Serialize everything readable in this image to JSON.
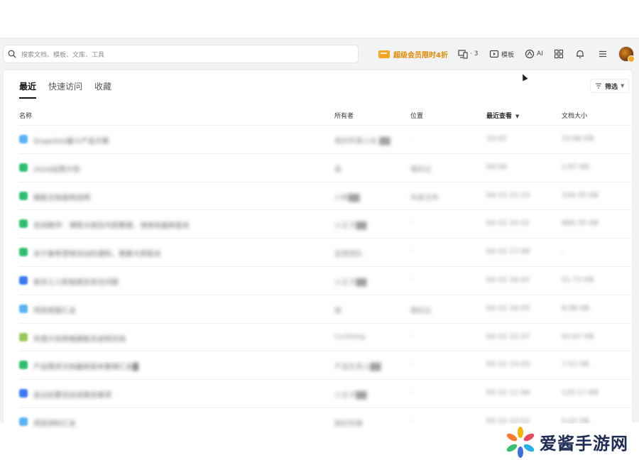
{
  "search": {
    "placeholder": "搜索文档、模板、文库、工具"
  },
  "toolbar": {
    "promo": "超级会员限时4折",
    "devices_count": "· 3",
    "templates": "模板",
    "ai": "AI"
  },
  "tabs": [
    {
      "label": "最近"
    },
    {
      "label": "快速访问"
    },
    {
      "label": "收藏"
    }
  ],
  "filter_label": "筛选",
  "table": {
    "headers": {
      "name": "名称",
      "owner": "所有者",
      "location": "位置",
      "last_viewed": "最近查看",
      "size": "文档大小"
    },
    "rows": [
      {
        "icon_color": "#5ab3f5",
        "name": "Snapshot最小产品方案",
        "owner": "我的同事小名 ▓▓",
        "location": "-",
        "date": "10:42",
        "size": "15.66 KB"
      },
      {
        "icon_color": "#2fbf71",
        "name": "2024运营计划",
        "owner": "我",
        "location": "我的云",
        "date": "09:58",
        "size": "2.87 KB"
      },
      {
        "icon_color": "#2fbf71",
        "name": "模板文档使用说明",
        "owner": "小明▓▓",
        "location": "共享文件",
        "date": "04-15 22:14",
        "size": "109.35 KB"
      },
      {
        "icon_color": "#2fbf71",
        "name": "在线教学：课程大纲及内容整理，请查收最新版本",
        "owner": "小王子▓▓",
        "location": "-",
        "date": "04-15 20:31",
        "size": "689.35 KB"
      },
      {
        "icon_color": "#2fbf71",
        "name": "关于春季营销活动的通知，需要大家配合",
        "owner": "运营团队",
        "location": "-",
        "date": "04-15 17:08",
        "size": "-"
      },
      {
        "icon_color": "#3b7af0",
        "name": "新员工入职指南及常见问题",
        "owner": "小王子▓▓",
        "location": "-",
        "date": "04-15 16:42",
        "size": "51.73 KB"
      },
      {
        "icon_color": "#5ab3f5",
        "name": "项目周报汇总",
        "owner": "我",
        "location": "我的云",
        "date": "04-15 16:05",
        "size": "8.98 KB"
      },
      {
        "icon_color": "#9cc85c",
        "name": "年度计划表格模板及说明文档",
        "owner": "LiuXiang",
        "location": "-",
        "date": "04-15 15:37",
        "size": "43.67 KB"
      },
      {
        "icon_color": "#2fbf71",
        "name": "产品需求文档最新版本整理汇总▓",
        "owner": "产品负责人▓▓",
        "location": "-",
        "date": "04-15 14:20",
        "size": "7.51 KB"
      },
      {
        "icon_color": "#3b7af0",
        "name": "会议纪要及后续跟进事项",
        "owner": "小王子▓▓",
        "location": "-",
        "date": "04-15 11:46",
        "size": "120.17 KB"
      },
      {
        "icon_color": "#5ab3f5",
        "name": "项目资料汇总",
        "owner": "我的同事",
        "location": "-",
        "date": "04-15 10:02",
        "size": "5.02 KB"
      }
    ]
  },
  "watermark": {
    "text": "爱酱手游网"
  }
}
